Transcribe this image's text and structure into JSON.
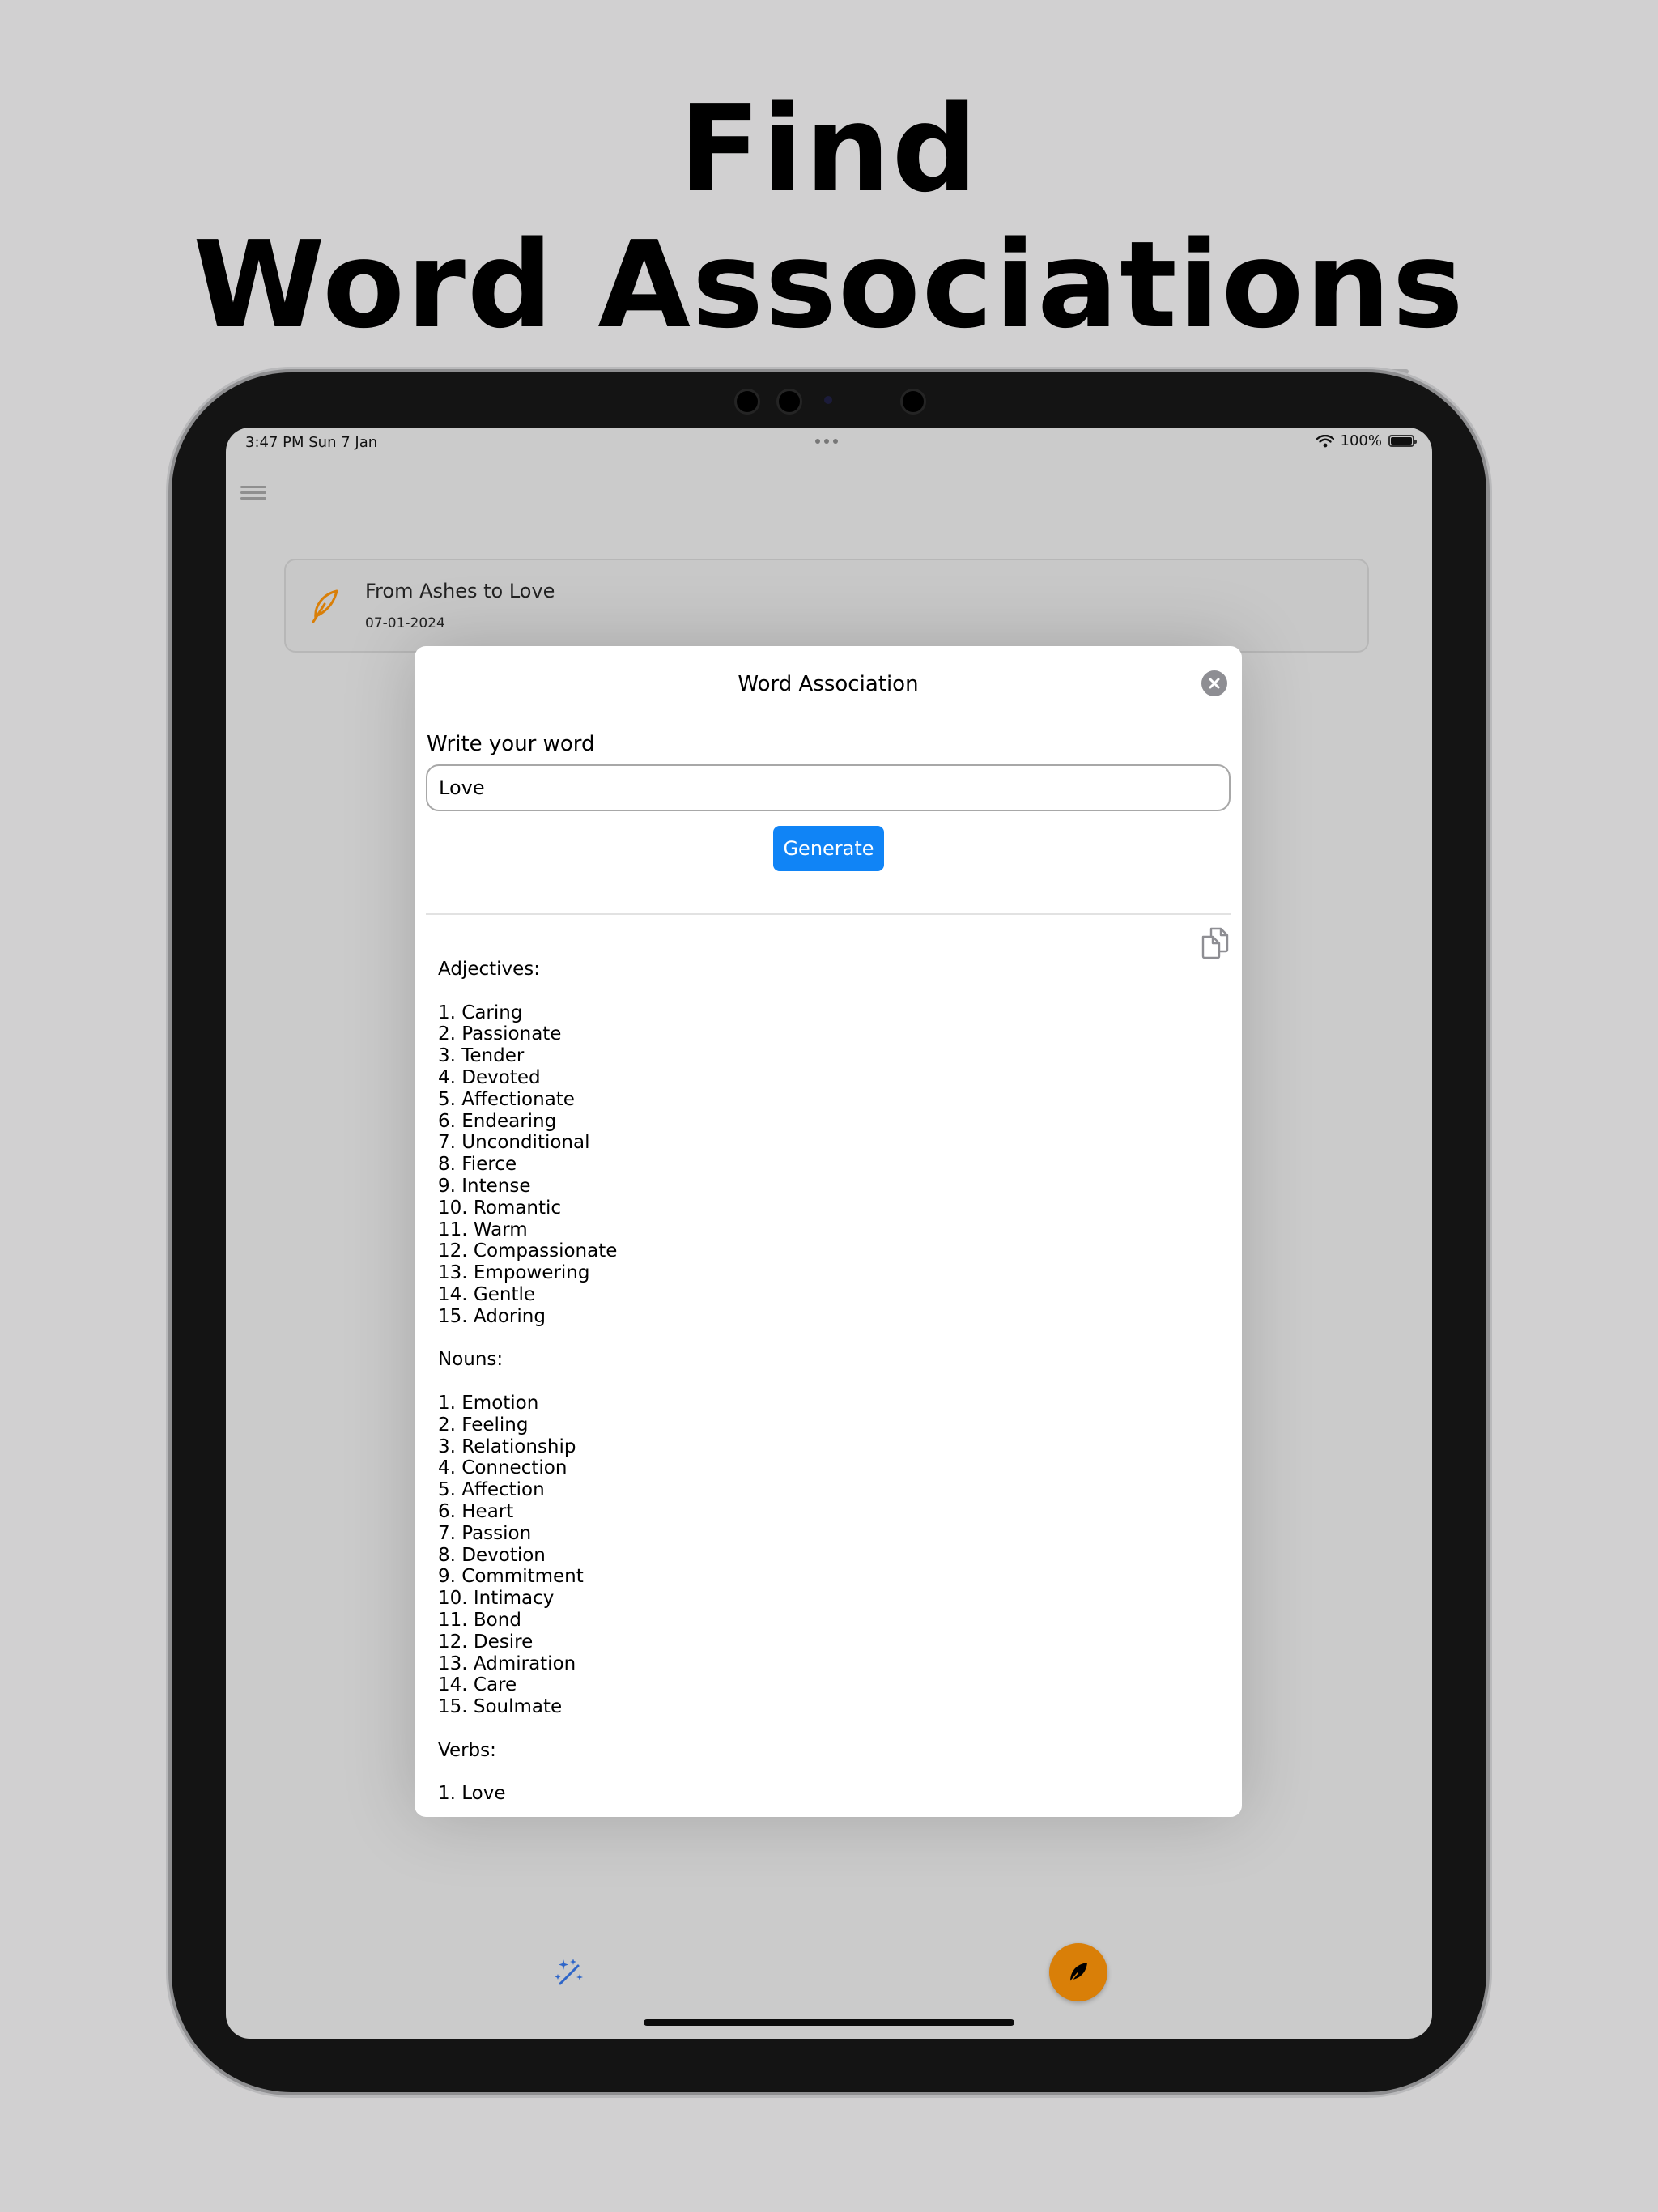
{
  "headline": {
    "line1": "Find",
    "line2": "Word Associations"
  },
  "status_bar": {
    "time_date": "3:47 PM   Sun 7 Jan",
    "battery": "100%"
  },
  "entry": {
    "title": "From Ashes to Love",
    "date": "07-01-2024"
  },
  "modal": {
    "title": "Word Association",
    "field_label": "Write your word",
    "input_value": "Love",
    "generate_label": "Generate",
    "results": [
      "Adjectives:",
      "",
      "1. Caring",
      "2. Passionate",
      "3. Tender",
      "4. Devoted",
      "5. Affectionate",
      "6. Endearing",
      "7. Unconditional",
      "8. Fierce",
      "9. Intense",
      "10. Romantic",
      "11. Warm",
      "12. Compassionate",
      "13. Empowering",
      "14. Gentle",
      "15. Adoring",
      "",
      "Nouns:",
      "",
      "1. Emotion",
      "2. Feeling",
      "3. Relationship",
      "4. Connection",
      "5. Affection",
      "6. Heart",
      "7. Passion",
      "8. Devotion",
      "9. Commitment",
      "10. Intimacy",
      "11. Bond",
      "12. Desire",
      "13. Admiration",
      "14. Care",
      "15. Soulmate",
      "",
      "Verbs:",
      "",
      "1. Love"
    ]
  },
  "colors": {
    "accent_blue": "#1084f6",
    "accent_orange": "#d97f08",
    "background": "#d1d0d1"
  },
  "icons": {
    "menu": "hamburger-menu-icon",
    "entry": "feather-icon",
    "close": "close-icon",
    "copy": "copy-icon",
    "magic": "magic-wand-icon",
    "fab": "feather-icon"
  }
}
